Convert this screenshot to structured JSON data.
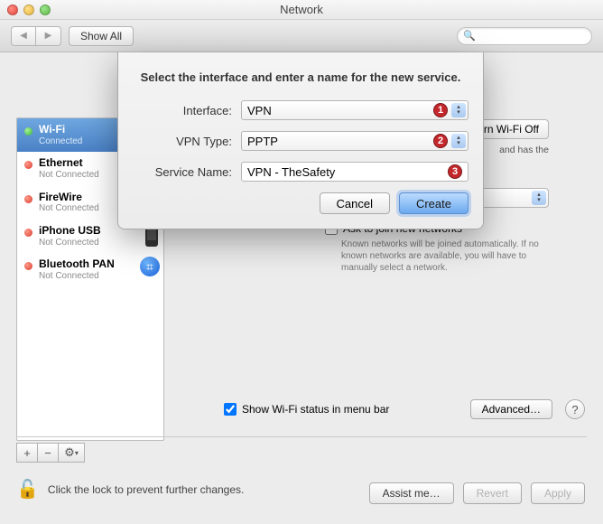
{
  "window": {
    "title": "Network"
  },
  "toolbar": {
    "show_all": "Show All",
    "search_placeholder": ""
  },
  "sidebar": {
    "items": [
      {
        "name": "Wi-Fi",
        "status": "Connected"
      },
      {
        "name": "Ethernet",
        "status": "Not Connected"
      },
      {
        "name": "FireWire",
        "status": "Not Connected"
      },
      {
        "name": "iPhone USB",
        "status": "Not Connected"
      },
      {
        "name": "Bluetooth PAN",
        "status": "Not Connected"
      }
    ],
    "buttons": {
      "add": "+",
      "remove": "−",
      "gear": "⚙",
      "gear_arrow": "▾"
    }
  },
  "main": {
    "turn_off": "Turn Wi-Fi Off",
    "connected_suffix": "and has the",
    "ask_label": "Ask to join new networks",
    "ask_info": "Known networks will be joined automatically. If no known networks are available, you will have to manually select a network.",
    "show_status": "Show Wi-Fi status in menu bar",
    "advanced": "Advanced…",
    "help": "?"
  },
  "lock": {
    "icon": "🔓",
    "text": "Click the lock to prevent further changes."
  },
  "footer": {
    "assist": "Assist me…",
    "revert": "Revert",
    "apply": "Apply"
  },
  "sheet": {
    "prompt": "Select the interface and enter a name for the new service.",
    "interface_label": "Interface:",
    "interface_value": "VPN",
    "vpntype_label": "VPN Type:",
    "vpntype_value": "PPTP",
    "servicename_label": "Service Name:",
    "servicename_value": "VPN - TheSafety",
    "cancel": "Cancel",
    "create": "Create",
    "badges": {
      "interface": "1",
      "vpntype": "2",
      "servicename": "3"
    }
  }
}
